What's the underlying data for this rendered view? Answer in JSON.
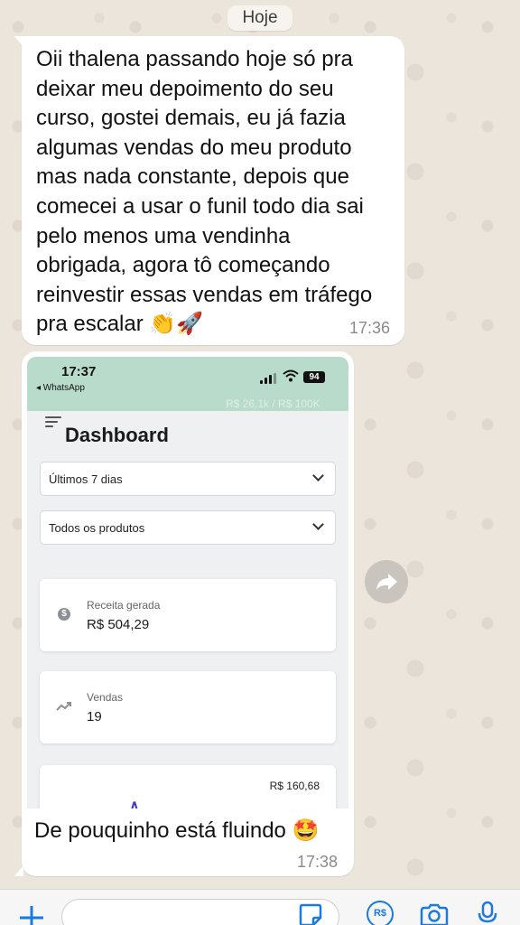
{
  "chat": {
    "date_label": "Hoje",
    "messages": [
      {
        "text": "Oii thalena passando hoje só pra\ndeixar meu depoimento do seu\ncurso, gostei demais, eu já fazia\nalgumas vendas do meu produto\nmas nada constante, depois que\ncomecei a usar o funil todo dia sai\npelo menos uma vendinha\nobrigada, agora tô começando\nreinvestir essas vendas em tráfego\npra escalar",
        "emojis": "👏🚀",
        "time": "17:36"
      },
      {
        "caption": "De pouquinho está fluindo",
        "emoji": "🤩",
        "time": "17:38"
      }
    ]
  },
  "screenshot": {
    "status_time": "17:37",
    "back_label": "◂ WhatsApp",
    "battery": "94",
    "progress_text": "R$ 26,1k / R$ 100K",
    "title": "Dashboard",
    "filters": [
      {
        "label": "Últimos 7 dias"
      },
      {
        "label": "Todos os produtos"
      }
    ],
    "cards": [
      {
        "label": "Receita gerada",
        "value": "R$ 504,29",
        "icon": "dollar-icon"
      },
      {
        "label": "Vendas",
        "value": "19",
        "icon": "trend-up-icon"
      }
    ],
    "partial_card_value": "R$ 160,68",
    "caret": "∧"
  },
  "input_bar": {
    "icons": [
      "plus-icon",
      "sticker-icon",
      "pix-icon",
      "camera-icon",
      "microphone-icon"
    ],
    "pix_label": "R$",
    "accent_color": "#1a7ae0"
  }
}
